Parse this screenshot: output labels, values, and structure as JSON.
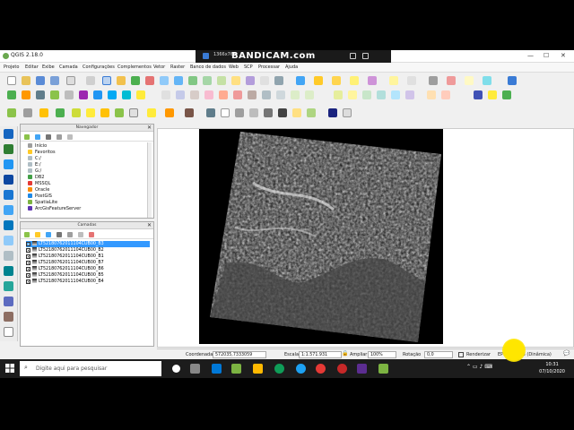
{
  "window": {
    "title": "QGIS 2.18.0",
    "minimize": "—",
    "maximize": "☐",
    "close": "✕"
  },
  "recorder": {
    "resolution": "1366x768",
    "brand": "BANDICAM.com"
  },
  "menu": [
    "Projeto",
    "Editar",
    "Exibe",
    "Camada",
    "Configurações",
    "Complementos",
    "Vetor",
    "Raster",
    "Banco de dados",
    "Web",
    "SCP",
    "Processar",
    "Ajuda"
  ],
  "browser_panel": {
    "title": "Navegador",
    "items": [
      "Início",
      "Favoritos",
      "C:/",
      "E:/",
      "G:/",
      "DB2",
      "MSSQL",
      "Oracle",
      "PostGIS",
      "SpatiaLite",
      "ArcGisFeatureServer"
    ]
  },
  "layers_panel": {
    "title": "Camadas",
    "layers": [
      "LT52180762011104CUB00_B3",
      "LT52180762011104CUB00_B2",
      "LT52180762011104CUB00_B1",
      "LT52180762011104CUB00_B7",
      "LT52180762011104CUB00_B6",
      "LT52180762011104CUB00_B5",
      "LT52180762011104CUB00_B4"
    ]
  },
  "statusbar": {
    "coord_label": "Coordenada",
    "coord_value": "572035,7333059",
    "scale_label": "Escala",
    "scale_value": "1:1.571.931",
    "magnify_label": "Ampliar",
    "magnify_value": "100%",
    "rotation_label": "Rotação",
    "rotation_value": "0,0",
    "render_label": "Renderizar",
    "crs_label": "EPSG:32723 (Dinâmica)"
  },
  "taskbar": {
    "search_placeholder": "Digite aqui para pesquisar",
    "time": "10:31",
    "date": "07/10/2020"
  },
  "colors": {
    "selection": "#3399ff",
    "taskbar": "#1c1c1c",
    "highlight": "#ffe600"
  }
}
